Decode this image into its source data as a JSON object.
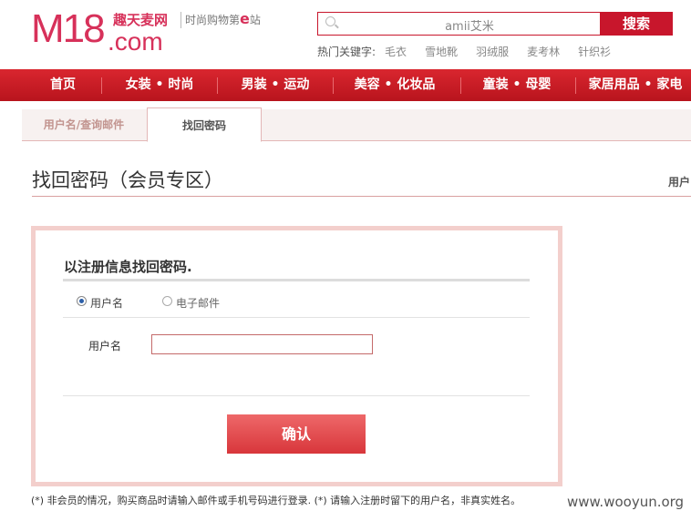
{
  "header": {
    "logo_text": "M18",
    "logo_com": ".com",
    "logo_cn": "趣天麦网",
    "slogan_pre": "时尚购物第",
    "slogan_e": "e",
    "slogan_post": "站"
  },
  "search": {
    "value": "amii艾米",
    "button": "搜索",
    "hot_label": "热门关键字:",
    "hot_keywords": [
      "毛衣",
      "雪地靴",
      "羽绒服",
      "麦考林",
      "针织衫"
    ]
  },
  "nav": [
    "首页",
    "女装 • 时尚",
    "男装 • 运动",
    "美容 • 化妆品",
    "童装 • 母婴",
    "家居用品 • 家电"
  ],
  "tabs": [
    "用户名/查询邮件",
    "找回密码"
  ],
  "page": {
    "title": "找回密码（会员专区）",
    "right_link": "用户"
  },
  "form": {
    "heading": "以注册信息找回密码.",
    "radio_username": "用户名",
    "radio_email": "电子邮件",
    "field_label": "用户名",
    "field_value": "",
    "submit": "确认"
  },
  "footnote": "(*) 非会员的情况，购买商品时请输入邮件或手机号码进行登录. (*) 请输入注册时留下的用户名，非真实姓名。",
  "watermark": "www.wooyun.org",
  "colors": {
    "brand": "#d7315a",
    "nav": "#c8162c",
    "button": "#e04a4d"
  }
}
